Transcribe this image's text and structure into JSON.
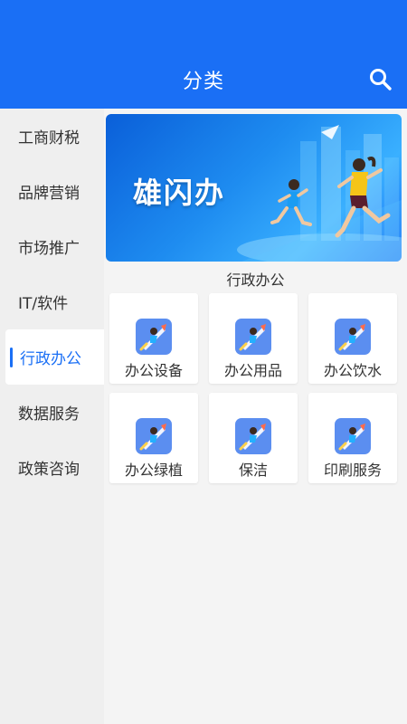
{
  "header": {
    "title": "分类",
    "search_icon": "search-icon"
  },
  "sidebar": {
    "items": [
      {
        "label": "工商财税"
      },
      {
        "label": "品牌营销"
      },
      {
        "label": "市场推广"
      },
      {
        "label": "IT/软件"
      },
      {
        "label": "行政办公",
        "active": true
      },
      {
        "label": "数据服务"
      },
      {
        "label": "政策咨询"
      }
    ]
  },
  "main": {
    "banner": {
      "text": "雄闪办"
    },
    "section_title": "行政办公",
    "items": [
      {
        "label": "办公设备",
        "icon": "rocket-icon"
      },
      {
        "label": "办公用品",
        "icon": "rocket-icon"
      },
      {
        "label": "办公饮水",
        "icon": "rocket-icon"
      },
      {
        "label": "办公绿植",
        "icon": "rocket-icon"
      },
      {
        "label": "保洁",
        "icon": "rocket-icon"
      },
      {
        "label": "印刷服务",
        "icon": "rocket-icon"
      }
    ]
  },
  "colors": {
    "accent": "#1a6ff5",
    "sidebar_bg": "#efefef",
    "main_bg": "#f4f4f4"
  }
}
